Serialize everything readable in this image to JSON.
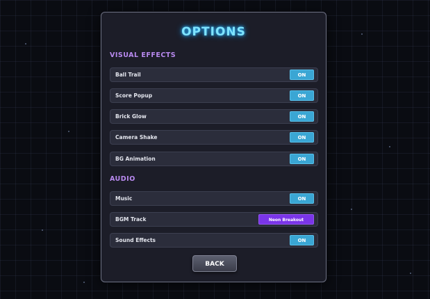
{
  "title": "OPTIONS",
  "sections": {
    "visual": {
      "heading": "VISUAL EFFECTS",
      "items": [
        {
          "label": "Ball Trail",
          "value": "ON"
        },
        {
          "label": "Score Popup",
          "value": "ON"
        },
        {
          "label": "Brick Glow",
          "value": "ON"
        },
        {
          "label": "Camera Shake",
          "value": "ON"
        },
        {
          "label": "BG Animation",
          "value": "ON"
        }
      ]
    },
    "audio": {
      "heading": "AUDIO",
      "music": {
        "label": "Music",
        "value": "ON"
      },
      "bgm": {
        "label": "BGM Track",
        "value": "Neon Breakout"
      },
      "sfx": {
        "label": "Sound Effects",
        "value": "ON"
      }
    }
  },
  "back_label": "BACK",
  "colors": {
    "title_glow": "#7fe4ff",
    "section_heading": "#b98af0",
    "toggle_on": "#3aa6d4",
    "select_accent": "#7a35e8",
    "panel_bg": "#1c1d28"
  }
}
